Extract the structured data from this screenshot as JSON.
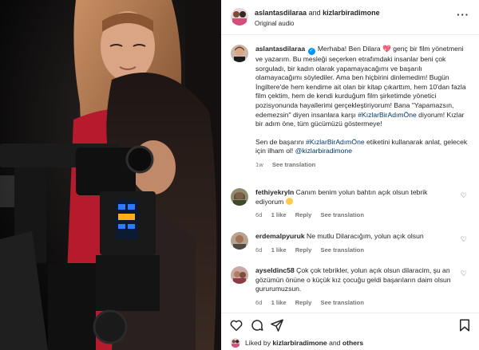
{
  "header": {
    "author": "aslantasdilaraa",
    "connector": "and",
    "collaborator": "kizlarbiradimone",
    "audio": "Original audio",
    "more_icon": "more-horizontal-icon"
  },
  "caption": {
    "username": "aslantasdilaraa",
    "para1_a": "Merhaba! Ben Dilara",
    "heart": "💖",
    "para1_b": "genç bir film yönetmeni ve yazarım. Bu mesleği seçerken etrafımdaki insanlar beni çok sorguladı, bir kadın olarak yapamayacağımı ve başarılı olamayacağımı söylediler. Ama ben hiçbirini dinlemedim! Bugün İngiltere'de hem kendime ait olan bir kitap çıkarttım, hem 10'dan fazla film çektim, hem de kendi kurduğum film şirketimde yönetici pozisyonunda hayallerimi gerçekleştiriyorum! Bana \"Yapamazsın, edemezsin\" diyen insanlara karşı",
    "para1_tag": "#KızlarBirAdımÖne",
    "para1_c": "diyorum! Kızlar bir adım öne, tüm gücümüzü göstermeye!",
    "para2_a": "Sen de başarını",
    "para2_tag": "#KızlarBirAdımÖne",
    "para2_b": "etiketini kullanarak anlat, gelecek için ilham ol!",
    "para2_mention": "@kizlarbiradimone",
    "time": "1w",
    "see_translation": "See translation"
  },
  "comments": [
    {
      "username": "fethiyekryln",
      "text": "Canım benim yolun bahtın açık olsun tebrik ediyorum",
      "emoji": "smile-emoji",
      "time": "6d",
      "likes": "1 like",
      "reply": "Reply",
      "translation": "See translation"
    },
    {
      "username": "erdemalpyuruk",
      "text": "Ne mutlu Dilaracığım, yolun açık olsun",
      "time": "6d",
      "likes": "1 like",
      "reply": "Reply",
      "translation": "See translation"
    },
    {
      "username": "ayseldinc58",
      "text": "Çok çok tebrikler, yolun açık olsun dilaracim, şu an gözümün önüne o küçük kız çocuğu geldi başarıların daim olsun gururumuzsun.",
      "time": "6d",
      "likes": "1 like",
      "reply": "Reply",
      "translation": "See translation"
    }
  ],
  "actions": {
    "icons": [
      "heart-icon",
      "comment-icon",
      "share-icon",
      "bookmark-icon"
    ],
    "liked_by_prefix": "Liked by",
    "liked_by_user": "kizlarbiradimone",
    "liked_by_and": "and",
    "liked_by_others": "others"
  },
  "colors": {
    "link": "#00376b",
    "verified": "#0095f6",
    "muted": "#737373",
    "text": "#262626"
  }
}
